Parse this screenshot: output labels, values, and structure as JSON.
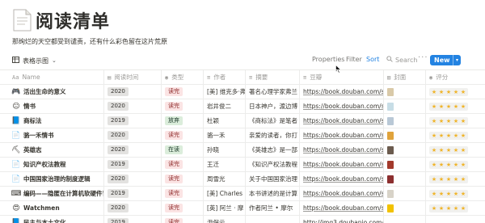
{
  "page": {
    "icon": "notebook-icon",
    "title": "阅读清单",
    "description": "那绚烂的天空都受到谴责，还有什么彩色留在这片荒原"
  },
  "toolbar": {
    "view_name": "表格示图",
    "properties": "Properties",
    "filter": "Filter",
    "sort": "Sort",
    "search": "Search",
    "more": "···",
    "new": "New"
  },
  "columns": [
    {
      "icon": "Aa",
      "label": "Name"
    },
    {
      "icon": "▤",
      "label": "阅读时间"
    },
    {
      "icon": "◉",
      "label": "类型"
    },
    {
      "icon": "≡",
      "label": "作者"
    },
    {
      "icon": "≡",
      "label": "摘要"
    },
    {
      "icon": "≡",
      "label": "豆瓣"
    },
    {
      "icon": "▥",
      "label": "封面"
    },
    {
      "icon": "◉",
      "label": "评分"
    }
  ],
  "rows": [
    {
      "emoji": "🎮",
      "name": "活出生命的意义",
      "year": "2020",
      "type": "读完",
      "type_kind": "read",
      "author": "[美] 维克多·弗",
      "summary": "著名心理学家弗兰",
      "douban": "https://book.douban.com/sub",
      "cover_color": "#d9c9a8",
      "rating": 5
    },
    {
      "emoji": "😐",
      "name": "情书",
      "year": "2020",
      "type": "读完",
      "type_kind": "read",
      "author": "岩井俊二",
      "summary": "日本神户，渡边博",
      "douban": "https://book.douban.com/sub",
      "cover_color": "#c7dde6",
      "rating": 5
    },
    {
      "emoji": "📘",
      "name": "商标法",
      "year": "2019",
      "type": "放弃",
      "type_kind": "drop",
      "author": "杜颖",
      "summary": "《商标法》是笔者",
      "douban": "https://book.douban.com/sub",
      "cover_color": "#b9c8d6",
      "rating": 5
    },
    {
      "emoji": "📄",
      "name": "骆一禾情书",
      "year": "2020",
      "type": "读完",
      "type_kind": "read",
      "author": "骆一禾",
      "summary": "亲爱的读者，你打",
      "douban": "https://book.douban.com/sub",
      "cover_color": "#e0a33c",
      "rating": 5
    },
    {
      "emoji": "⛏",
      "name": "英雄志",
      "year": "2020",
      "type": "在读",
      "type_kind": "reading",
      "author": "孙晓",
      "summary": "《英雄志》是一部",
      "douban": "https://book.douban.com/sub",
      "cover_color": "#6b5b4e",
      "rating": 5
    },
    {
      "emoji": "📄",
      "name": "知识产权法教程",
      "year": "2019",
      "type": "读完",
      "type_kind": "read",
      "author": "王迁",
      "summary": "《知识产权法教程",
      "douban": "https://book.douban.com/sub",
      "cover_color": "#a33a2c",
      "rating": 5
    },
    {
      "emoji": "📄",
      "name": "中国国家治理的制度逻辑",
      "year": "2020",
      "type": "读完",
      "type_kind": "read",
      "author": "周雪光",
      "summary": "关于中国国家治理",
      "douban": "https://book.douban.com/sub",
      "cover_color": "#8c2f2f",
      "rating": 5
    },
    {
      "emoji": "⌨",
      "name": "编码——隐匿在计算机软硬件背",
      "year": "2019",
      "type": "读完",
      "type_kind": "read",
      "author": "[美] Charles Pe",
      "summary": "本书讲述的是计算",
      "douban": "https://book.douban.com/sub",
      "cover_color": "#d8d3c8",
      "rating": 5
    },
    {
      "emoji": "😍",
      "name": "Watchmen",
      "year": "2020",
      "type": "读完",
      "type_kind": "read",
      "author": "[英] 阿兰 · 摩",
      "summary": "作者阿兰 • 摩尔",
      "douban": "https://book.douban.com/sub",
      "cover_color": "#f2c200",
      "rating": 5
    },
    {
      "emoji": "📘",
      "name": "民主与本土文化",
      "year": "2019",
      "type": "读完",
      "type_kind": "read",
      "author": "尹保云",
      "summary": "",
      "douban": "http://img3.doubanio.com/vie",
      "cover_color": "#ffffff",
      "rating": 0
    }
  ]
}
